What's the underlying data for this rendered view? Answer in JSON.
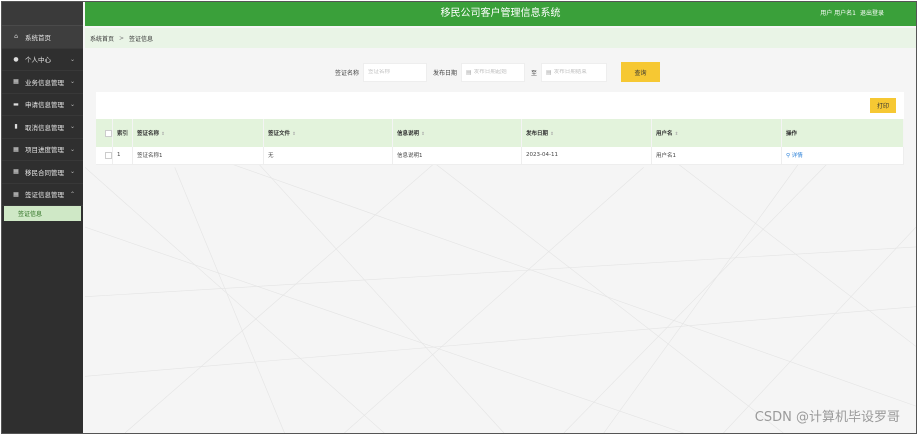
{
  "app": {
    "title": "移民公司客户管理信息系统",
    "user_text": "用户 用户名1",
    "logout_label": "退出登录"
  },
  "sidebar": {
    "items": [
      {
        "label": "系统首页",
        "icon": "home-icon",
        "glyph": "⌂",
        "arrow": ""
      },
      {
        "label": "个人中心",
        "icon": "user-icon",
        "glyph": "●",
        "arrow": "⌄"
      },
      {
        "label": "业务信息管理",
        "icon": "grid-icon",
        "glyph": "▦",
        "arrow": "⌄"
      },
      {
        "label": "申请信息管理",
        "icon": "folder-icon",
        "glyph": "▬",
        "arrow": "⌄"
      },
      {
        "label": "取消信息管理",
        "icon": "document-icon",
        "glyph": "▮",
        "arrow": "⌄"
      },
      {
        "label": "项目进度管理",
        "icon": "grid-icon",
        "glyph": "▦",
        "arrow": "⌄"
      },
      {
        "label": "移民合同管理",
        "icon": "grid-icon",
        "glyph": "▦",
        "arrow": "⌄"
      },
      {
        "label": "签证信息管理",
        "icon": "grid-icon",
        "glyph": "▦",
        "arrow": "⌃"
      }
    ],
    "sub_item": "签证信息"
  },
  "breadcrumb": {
    "home": "系统首页",
    "separator": ">",
    "current": "签证信息"
  },
  "search": {
    "name_label": "签证名称",
    "name_placeholder": "签证名称",
    "date_label": "发布日期",
    "start_placeholder": "发布日期起始",
    "to_label": "至",
    "end_placeholder": "发布日期结束",
    "query_label": "查询"
  },
  "toolbar": {
    "print_label": "打印"
  },
  "table": {
    "headers": [
      "索引",
      "签证名称",
      "签证文件",
      "信息说明",
      "发布日期",
      "用户名",
      "操作"
    ],
    "rows": [
      {
        "index": "1",
        "name": "签证名称1",
        "file": "无",
        "desc": "信息说明1",
        "date": "2023-04-11",
        "user": "用户名1",
        "action": "详情"
      }
    ]
  },
  "watermark": "CSDN @计算机毕设罗哥",
  "colors": {
    "header_green": "#3aa03a",
    "sidebar_dark": "#2f2f2f",
    "accent_yellow": "#f6c833",
    "table_header_bg": "#e3f3dc",
    "link_blue": "#2f83d9"
  }
}
